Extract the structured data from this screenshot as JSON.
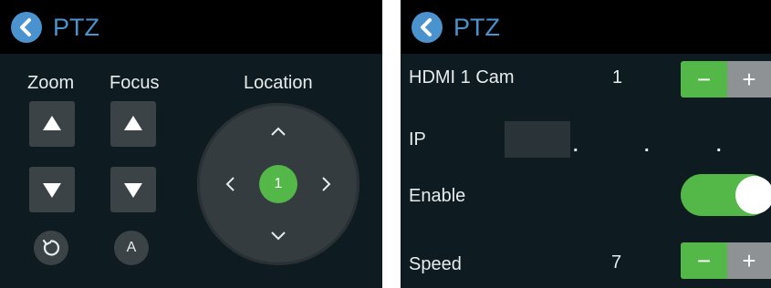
{
  "left_panel": {
    "title": "PTZ",
    "back_icon": "chevron-left-icon",
    "zoom": {
      "label": "Zoom",
      "up_icon": "triangle-up-icon",
      "down_icon": "triangle-down-icon",
      "reset_icon": "rotate-icon"
    },
    "focus": {
      "label": "Focus",
      "up_icon": "triangle-up-icon",
      "down_icon": "triangle-down-icon",
      "auto_label": "A"
    },
    "location": {
      "label": "Location",
      "preset": "1"
    }
  },
  "right_panel": {
    "title": "PTZ",
    "back_icon": "chevron-left-icon",
    "cam": {
      "label": "HDMI 1 Cam",
      "value": "1",
      "minus": "−",
      "plus": "+"
    },
    "ip": {
      "label": "IP",
      "value": "",
      "dots": [
        ".",
        ".",
        "."
      ]
    },
    "enable": {
      "label": "Enable",
      "on": true
    },
    "speed": {
      "label": "Speed",
      "value": "7",
      "minus": "−",
      "plus": "+"
    }
  },
  "colors": {
    "accent": "#4b93cf",
    "green": "#53b848",
    "panel": "#0e1c21",
    "button": "#3c4346"
  }
}
